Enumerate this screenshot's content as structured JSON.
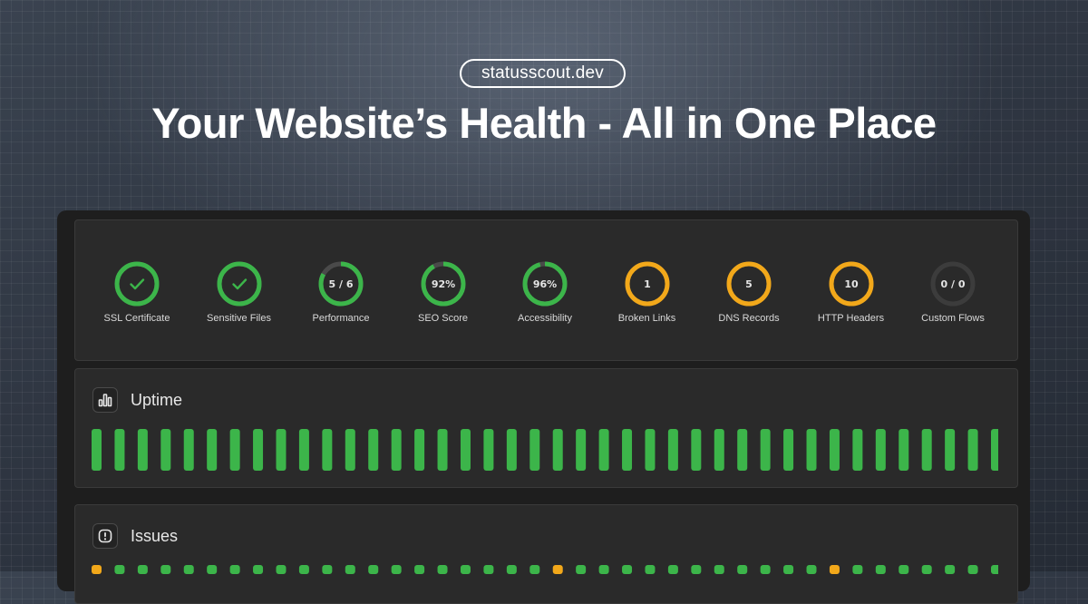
{
  "header": {
    "domain": "statusscout.dev",
    "headline": "Your Website’s Health - All in One Place"
  },
  "colors": {
    "green": "#3cb54a",
    "amber": "#f2a81a",
    "track": "#4a4a4a",
    "gray": "#3c3c3c"
  },
  "checks": [
    {
      "label": "SSL Certificate",
      "icon": "check-icon",
      "value": "",
      "color": "green",
      "progress": 1.0
    },
    {
      "label": "Sensitive Files",
      "icon": "check-icon",
      "value": "",
      "color": "green",
      "progress": 1.0
    },
    {
      "label": "Performance",
      "value": "5 / 6",
      "color": "green",
      "progress": 0.83
    },
    {
      "label": "SEO Score",
      "value": "92%",
      "color": "green",
      "progress": 0.92
    },
    {
      "label": "Accessibility",
      "value": "96%",
      "color": "green",
      "progress": 0.96
    },
    {
      "label": "Broken Links",
      "value": "1",
      "color": "amber",
      "progress": 1.0
    },
    {
      "label": "DNS Records",
      "value": "5",
      "color": "amber",
      "progress": 1.0
    },
    {
      "label": "HTTP Headers",
      "value": "10",
      "color": "amber",
      "progress": 1.0
    },
    {
      "label": "Custom Flows",
      "value": "0 / 0",
      "color": "gray",
      "progress": 1.0
    }
  ],
  "uptime": {
    "title": "Uptime",
    "icon": "bar-chart-icon",
    "bars": [
      "up",
      "up",
      "up",
      "up",
      "up",
      "up",
      "up",
      "up",
      "up",
      "up",
      "up",
      "up",
      "up",
      "up",
      "up",
      "up",
      "up",
      "up",
      "up",
      "up",
      "up",
      "up",
      "up",
      "up",
      "up",
      "up",
      "up",
      "up",
      "up",
      "up",
      "up",
      "up",
      "up",
      "up",
      "up",
      "up",
      "up",
      "up",
      "up",
      "up"
    ]
  },
  "issues": {
    "title": "Issues",
    "icon": "alert-icon",
    "dots": [
      "warn",
      "ok",
      "ok",
      "ok",
      "ok",
      "ok",
      "ok",
      "ok",
      "ok",
      "ok",
      "ok",
      "ok",
      "ok",
      "ok",
      "ok",
      "ok",
      "ok",
      "ok",
      "ok",
      "ok",
      "warn",
      "ok",
      "ok",
      "ok",
      "ok",
      "ok",
      "ok",
      "ok",
      "ok",
      "ok",
      "ok",
      "ok",
      "warn",
      "ok",
      "ok",
      "ok",
      "ok",
      "ok",
      "ok",
      "ok"
    ]
  }
}
